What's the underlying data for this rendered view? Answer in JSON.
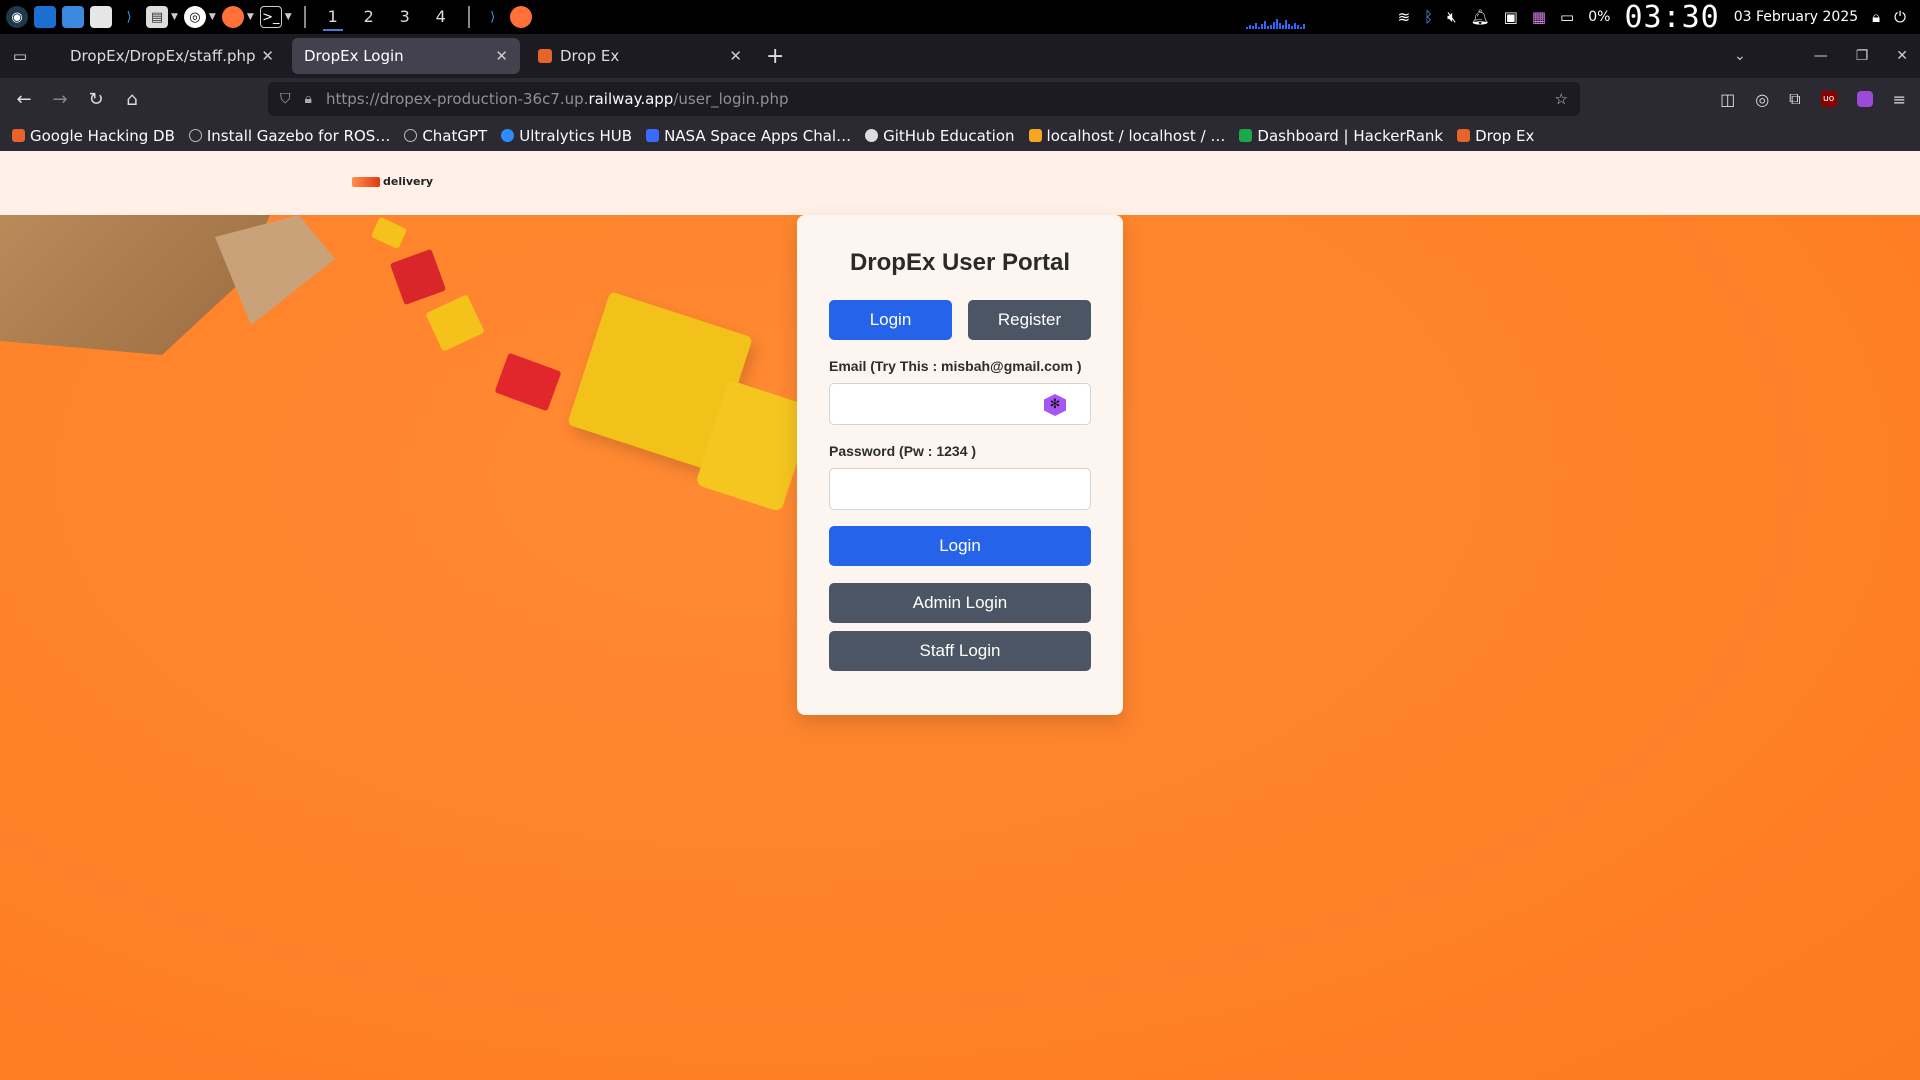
{
  "taskbar": {
    "workspaces": [
      "1",
      "2",
      "3",
      "4"
    ],
    "battery_percent": "0%",
    "clock": "03:30",
    "date": "03 February 2025"
  },
  "browser": {
    "tabs": [
      {
        "title": "DropEx/DropEx/staff.php"
      },
      {
        "title": "DropEx Login"
      },
      {
        "title": "Drop Ex"
      }
    ],
    "url": {
      "prefix": "https://dropex-production-36c7.up.",
      "host": "railway.app",
      "path": "/user_login.php"
    },
    "bookmarks": [
      {
        "label": "Google Hacking DB",
        "color": "#e8632a"
      },
      {
        "label": "Install Gazebo for ROS…",
        "color": "#bbbbbb"
      },
      {
        "label": "ChatGPT",
        "color": "#bbbbbb"
      },
      {
        "label": "Ultralytics HUB",
        "color": "#2f8cff"
      },
      {
        "label": "NASA Space Apps Chal…",
        "color": "#3a6bff"
      },
      {
        "label": "GitHub Education",
        "color": "#dddddd"
      },
      {
        "label": "localhost / localhost / …",
        "color": "#f5a623"
      },
      {
        "label": "Dashboard | HackerRank",
        "color": "#1ba94c"
      },
      {
        "label": "Drop Ex",
        "color": "#e8632a"
      }
    ]
  },
  "site": {
    "logo_text": "delivery"
  },
  "login_card": {
    "title": "DropEx User Portal",
    "toggle_login": "Login",
    "toggle_register": "Register",
    "email_label": "Email (Try This : misbah@gmail.com )",
    "email_value": "",
    "password_label": "Password (Pw : 1234 )",
    "password_value": "",
    "submit_label": "Login",
    "admin_label": "Admin Login",
    "staff_label": "Staff Login"
  },
  "colors": {
    "primary_blue": "#2563eb",
    "secondary_grey": "#4b5563",
    "page_orange": "#ff8c2a",
    "header_cream": "#fff1e8"
  }
}
